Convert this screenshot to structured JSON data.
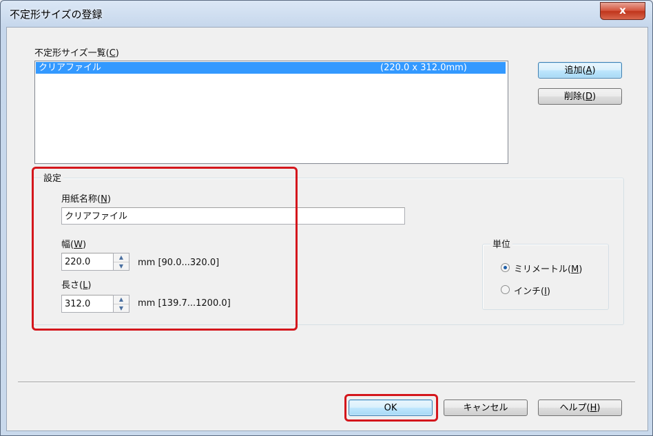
{
  "window": {
    "title": "不定形サイズの登録",
    "close_glyph": "x"
  },
  "size_list": {
    "label": "不定形サイズ一覧(",
    "label_key": "C",
    "label_end": ")",
    "items": [
      {
        "name": "クリアファイル",
        "dims": "(220.0 x 312.0mm)"
      }
    ]
  },
  "buttons": {
    "add": {
      "text": "追加(",
      "key": "A",
      "end": ")"
    },
    "delete": {
      "text": "削除(",
      "key": "D",
      "end": ")"
    },
    "ok": "OK",
    "cancel": "キャンセル",
    "help": {
      "text": "ヘルプ(",
      "key": "H",
      "end": ")"
    }
  },
  "settings": {
    "group_label": "設定",
    "paper_name": {
      "label": "用紙名称(",
      "key": "N",
      "end": ")",
      "value": "クリアファイル"
    },
    "width": {
      "label": "幅(",
      "key": "W",
      "end": ")",
      "value": "220.0",
      "range": "mm [90.0...320.0]"
    },
    "length": {
      "label": "長さ(",
      "key": "L",
      "end": ")",
      "value": "312.0",
      "range": "mm [139.7...1200.0]"
    }
  },
  "unit": {
    "group_label": "単位",
    "options": [
      {
        "text": "ミリメートル(",
        "key": "M",
        "end": ")",
        "selected": true
      },
      {
        "text": "インチ(",
        "key": "I",
        "end": ")",
        "selected": false
      }
    ]
  },
  "icons": {
    "spin_up": "▲",
    "spin_down": "▼"
  },
  "colors": {
    "highlight": "#d4161c",
    "selection": "#3399ff"
  }
}
